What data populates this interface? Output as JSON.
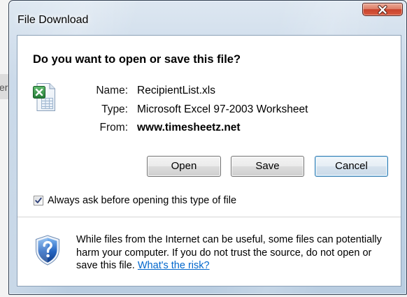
{
  "background": {
    "partial_text": "er"
  },
  "window": {
    "title": "File Download",
    "close_icon": "close-icon"
  },
  "dialog": {
    "question": "Do you want to open or save this file?",
    "file": {
      "icon": "excel-file-icon",
      "fields": [
        {
          "label": "Name:",
          "value": "RecipientList.xls"
        },
        {
          "label": "Type:",
          "value": "Microsoft Excel 97-2003 Worksheet"
        },
        {
          "label": "From:",
          "value": "www.timesheetz.net"
        }
      ]
    },
    "buttons": [
      {
        "label": "Open",
        "focused": false
      },
      {
        "label": "Save",
        "focused": false
      },
      {
        "label": "Cancel",
        "focused": true
      }
    ],
    "always_ask": {
      "label": "Always ask before opening this type of file",
      "checked": true,
      "check_icon": "checkmark-icon"
    },
    "warning": {
      "icon": "security-shield-question-icon",
      "lines": [
        "While files from the Internet can be useful, some files can potentially",
        "harm your computer. If you do not trust the source, do not open or",
        "save this file."
      ],
      "link": "What's the risk?"
    }
  },
  "colors": {
    "frame": "#c7d7e8",
    "close_button": "#c8432c",
    "focus_border": "#3c7fb1",
    "link": "#0066cc",
    "shield_blue": "#2464c0",
    "excel_green": "#237a35"
  }
}
